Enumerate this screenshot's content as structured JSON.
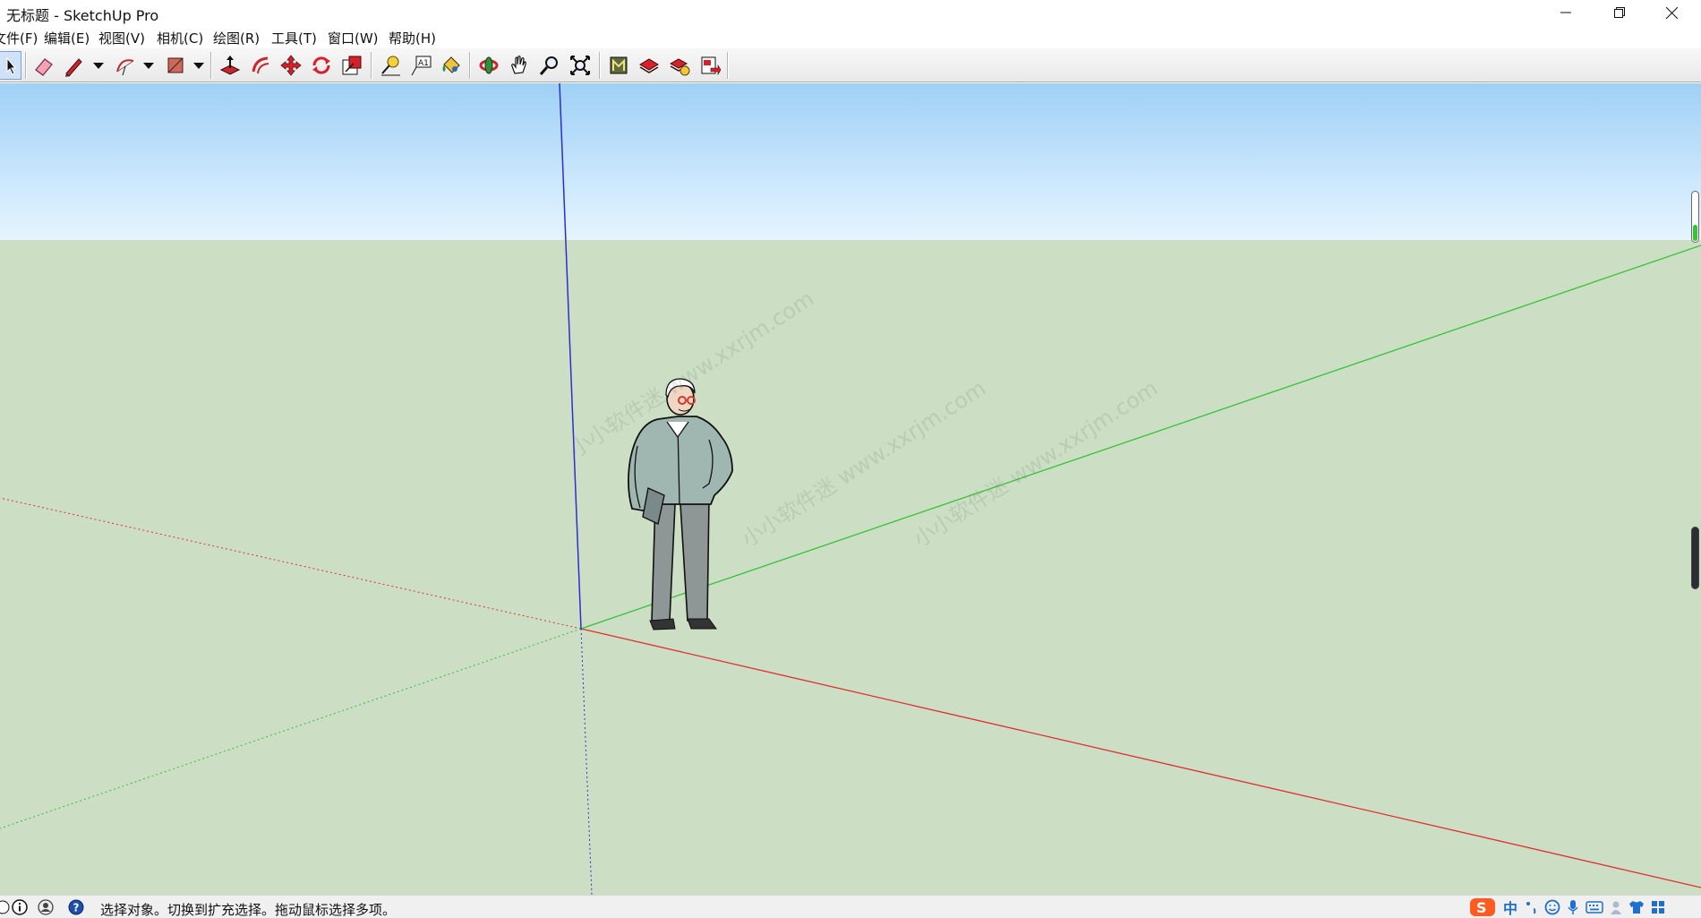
{
  "window": {
    "title": "无标题 - SketchUp Pro"
  },
  "menu": {
    "items": [
      {
        "label": "文件(F)"
      },
      {
        "label": "编辑(E)"
      },
      {
        "label": "视图(V)"
      },
      {
        "label": "相机(C)"
      },
      {
        "label": "绘图(R)"
      },
      {
        "label": "工具(T)"
      },
      {
        "label": "窗口(W)"
      },
      {
        "label": "帮助(H)"
      }
    ]
  },
  "toolbar": {
    "tools": [
      {
        "name": "select-tool",
        "icon": "arrow-cursor-icon",
        "active": true
      },
      {
        "name": "eraser-tool",
        "icon": "eraser-icon"
      },
      {
        "name": "line-tool",
        "icon": "pencil-icon"
      },
      {
        "name": "arc-tool",
        "icon": "arc-icon"
      },
      {
        "name": "rectangle-tool",
        "icon": "rectangle-icon"
      },
      {
        "name": "push-pull-tool",
        "icon": "push-pull-icon"
      },
      {
        "name": "offset-tool",
        "icon": "offset-icon"
      },
      {
        "name": "move-tool",
        "icon": "move-icon"
      },
      {
        "name": "rotate-tool",
        "icon": "rotate-icon"
      },
      {
        "name": "scale-tool",
        "icon": "scale-icon"
      },
      {
        "name": "tape-measure-tool",
        "icon": "tape-measure-icon"
      },
      {
        "name": "text-tool",
        "icon": "text-icon"
      },
      {
        "name": "paint-bucket-tool",
        "icon": "paint-bucket-icon"
      },
      {
        "name": "orbit-tool",
        "icon": "orbit-icon"
      },
      {
        "name": "pan-tool",
        "icon": "hand-icon"
      },
      {
        "name": "zoom-tool",
        "icon": "magnifier-icon"
      },
      {
        "name": "zoom-extents-tool",
        "icon": "zoom-extents-icon"
      },
      {
        "name": "3d-warehouse-tool",
        "icon": "warehouse-icon"
      },
      {
        "name": "extension-warehouse-tool",
        "icon": "extension-warehouse-icon"
      },
      {
        "name": "extension-manager-tool",
        "icon": "extension-manager-icon"
      },
      {
        "name": "send-to-layout-tool",
        "icon": "layout-icon"
      }
    ]
  },
  "viewport": {
    "sky_color": "#cfe8fb",
    "ground_color": "#ccdfc5",
    "axes": {
      "red": "#e03030",
      "green": "#36c236",
      "blue": "#2e2ecf"
    },
    "watermark": "小小软件迷 www.xxrjm.com"
  },
  "status": {
    "icons": [
      "info-icon",
      "user-icon",
      "help-icon"
    ],
    "text": "选择对象。切换到扩充选择。拖动鼠标选择多项。"
  },
  "ime": {
    "label": "中",
    "icons": [
      "sogou-icon",
      "punctuation-icon",
      "emoji-icon",
      "microphone-icon",
      "keyboard-icon",
      "user-icon",
      "shirt-icon",
      "grid-icon"
    ],
    "brand_color": "#ff5a1f"
  }
}
